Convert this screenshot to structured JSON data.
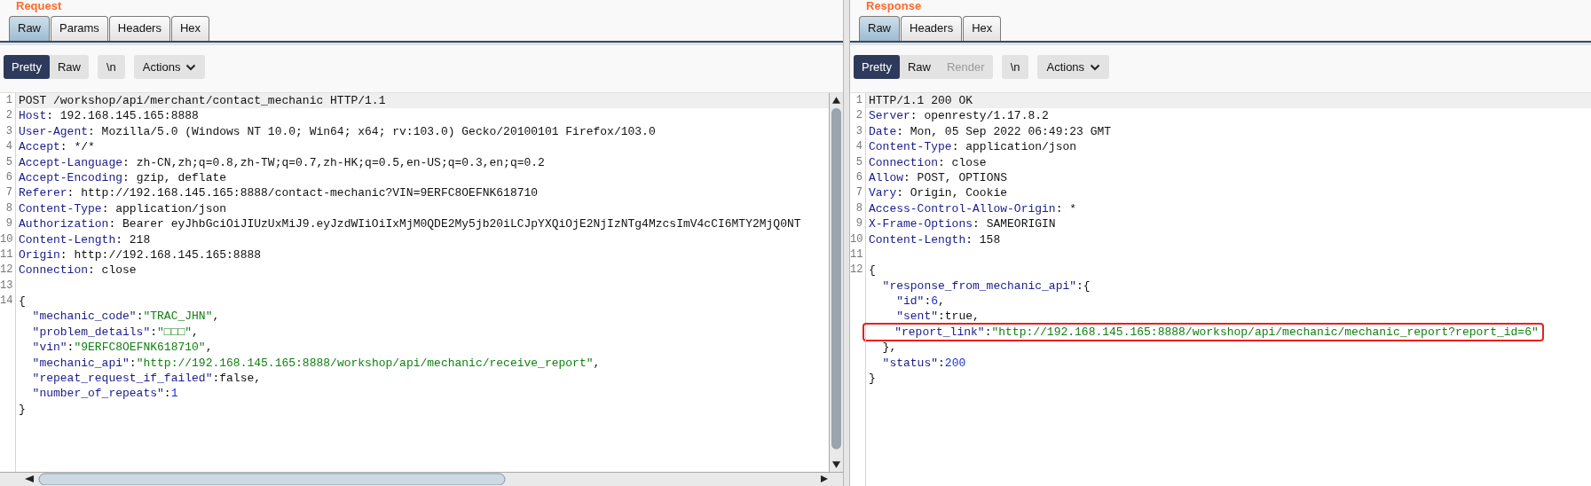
{
  "request": {
    "title": "Request",
    "scrollbars": true,
    "tabs": [
      {
        "label": "Raw",
        "selected": true
      },
      {
        "label": "Params",
        "selected": false
      },
      {
        "label": "Headers",
        "selected": false
      },
      {
        "label": "Hex",
        "selected": false
      }
    ],
    "view_modes": [
      {
        "label": "Pretty",
        "selected": true,
        "disabled": false
      },
      {
        "label": "Raw",
        "selected": false,
        "disabled": false
      }
    ],
    "newline_button": "\\n",
    "actions_button": "Actions",
    "lines": [
      {
        "num": "1",
        "current": true,
        "highlighted": false,
        "tokens": [
          {
            "kind": "text",
            "text": "POST /workshop/api/merchant/contact_mechanic HTTP/1.1"
          }
        ]
      },
      {
        "num": "2",
        "current": false,
        "highlighted": false,
        "tokens": [
          {
            "kind": "name",
            "text": "Host"
          },
          {
            "kind": "text",
            "text": ": 192.168.145.165:8888"
          }
        ]
      },
      {
        "num": "3",
        "current": false,
        "highlighted": false,
        "tokens": [
          {
            "kind": "name",
            "text": "User-Agent"
          },
          {
            "kind": "text",
            "text": ": Mozilla/5.0 (Windows NT 10.0; Win64; x64; rv:103.0) Gecko/20100101 Firefox/103.0"
          }
        ]
      },
      {
        "num": "4",
        "current": false,
        "highlighted": false,
        "tokens": [
          {
            "kind": "name",
            "text": "Accept"
          },
          {
            "kind": "text",
            "text": ": */*"
          }
        ]
      },
      {
        "num": "5",
        "current": false,
        "highlighted": false,
        "tokens": [
          {
            "kind": "name",
            "text": "Accept-Language"
          },
          {
            "kind": "text",
            "text": ": zh-CN,zh;q=0.8,zh-TW;q=0.7,zh-HK;q=0.5,en-US;q=0.3,en;q=0.2"
          }
        ]
      },
      {
        "num": "6",
        "current": false,
        "highlighted": false,
        "tokens": [
          {
            "kind": "name",
            "text": "Accept-Encoding"
          },
          {
            "kind": "text",
            "text": ": gzip, deflate"
          }
        ]
      },
      {
        "num": "7",
        "current": false,
        "highlighted": false,
        "tokens": [
          {
            "kind": "name",
            "text": "Referer"
          },
          {
            "kind": "text",
            "text": ": http://192.168.145.165:8888/contact-mechanic?VIN=9ERFC8OEFNK618710"
          }
        ]
      },
      {
        "num": "8",
        "current": false,
        "highlighted": false,
        "tokens": [
          {
            "kind": "name",
            "text": "Content-Type"
          },
          {
            "kind": "text",
            "text": ": application/json"
          }
        ]
      },
      {
        "num": "9",
        "current": false,
        "highlighted": false,
        "tokens": [
          {
            "kind": "name",
            "text": "Authorization"
          },
          {
            "kind": "text",
            "text": ": Bearer eyJhbGciOiJIUzUxMiJ9.eyJzdWIiOiIxMjM0QDE2My5jb20iLCJpYXQiOjE2NjIzNTg4MzcsImV4cCI6MTY2MjQ0NT"
          }
        ]
      },
      {
        "num": "10",
        "current": false,
        "highlighted": false,
        "tokens": [
          {
            "kind": "name",
            "text": "Content-Length"
          },
          {
            "kind": "text",
            "text": ": 218"
          }
        ]
      },
      {
        "num": "11",
        "current": false,
        "highlighted": false,
        "tokens": [
          {
            "kind": "name",
            "text": "Origin"
          },
          {
            "kind": "text",
            "text": ": http://192.168.145.165:8888"
          }
        ]
      },
      {
        "num": "12",
        "current": false,
        "highlighted": false,
        "tokens": [
          {
            "kind": "name",
            "text": "Connection"
          },
          {
            "kind": "text",
            "text": ": close"
          }
        ]
      },
      {
        "num": "13"
      },
      {
        "num": "14",
        "current": false,
        "highlighted": false,
        "tokens": [
          {
            "kind": "text",
            "text": "{"
          }
        ]
      },
      {
        "current": false,
        "highlighted": false,
        "tokens": [
          {
            "kind": "name",
            "text": "  \"mechanic_code\""
          },
          {
            "kind": "text",
            "text": ":"
          },
          {
            "kind": "string",
            "text": "\"TRAC_JHN\""
          },
          {
            "kind": "text",
            "text": ","
          }
        ]
      },
      {
        "current": false,
        "highlighted": false,
        "tokens": [
          {
            "kind": "name",
            "text": "  \"problem_details\""
          },
          {
            "kind": "text",
            "text": ":"
          },
          {
            "kind": "string",
            "text": "\"□□□\""
          },
          {
            "kind": "text",
            "text": ","
          }
        ]
      },
      {
        "current": false,
        "highlighted": false,
        "tokens": [
          {
            "kind": "name",
            "text": "  \"vin\""
          },
          {
            "kind": "text",
            "text": ":"
          },
          {
            "kind": "string",
            "text": "\"9ERFC8OEFNK618710\""
          },
          {
            "kind": "text",
            "text": ","
          }
        ]
      },
      {
        "current": false,
        "highlighted": false,
        "tokens": [
          {
            "kind": "name",
            "text": "  \"mechanic_api\""
          },
          {
            "kind": "text",
            "text": ":"
          },
          {
            "kind": "string",
            "text": "\"http://192.168.145.165:8888/workshop/api/mechanic/receive_report\""
          },
          {
            "kind": "text",
            "text": ","
          }
        ]
      },
      {
        "current": false,
        "highlighted": false,
        "tokens": [
          {
            "kind": "name",
            "text": "  \"repeat_request_if_failed\""
          },
          {
            "kind": "text",
            "text": ":false,"
          }
        ]
      },
      {
        "current": false,
        "highlighted": false,
        "tokens": [
          {
            "kind": "name",
            "text": "  \"number_of_repeats\""
          },
          {
            "kind": "text",
            "text": ":"
          },
          {
            "kind": "number",
            "text": "1"
          }
        ]
      },
      {
        "current": false,
        "highlighted": false,
        "tokens": [
          {
            "kind": "text",
            "text": "}"
          }
        ]
      }
    ]
  },
  "response": {
    "title": "Response",
    "tabs": [
      {
        "label": "Raw",
        "selected": true
      },
      {
        "label": "Headers",
        "selected": false
      },
      {
        "label": "Hex",
        "selected": false
      }
    ],
    "view_modes": [
      {
        "label": "Pretty",
        "selected": true,
        "disabled": false
      },
      {
        "label": "Raw",
        "selected": false,
        "disabled": false
      },
      {
        "label": "Render",
        "selected": false,
        "disabled": true
      }
    ],
    "newline_button": "\\n",
    "actions_button": "Actions",
    "lines": [
      {
        "num": "1",
        "current": true,
        "highlighted": false,
        "tokens": [
          {
            "kind": "text",
            "text": "HTTP/1.1 200 OK"
          }
        ]
      },
      {
        "num": "2",
        "current": false,
        "highlighted": false,
        "tokens": [
          {
            "kind": "name",
            "text": "Server"
          },
          {
            "kind": "text",
            "text": ": openresty/1.17.8.2"
          }
        ]
      },
      {
        "num": "3",
        "current": false,
        "highlighted": false,
        "tokens": [
          {
            "kind": "name",
            "text": "Date"
          },
          {
            "kind": "text",
            "text": ": Mon, 05 Sep 2022 06:49:23 GMT"
          }
        ]
      },
      {
        "num": "4",
        "current": false,
        "highlighted": false,
        "tokens": [
          {
            "kind": "name",
            "text": "Content-Type"
          },
          {
            "kind": "text",
            "text": ": application/json"
          }
        ]
      },
      {
        "num": "5",
        "current": false,
        "highlighted": false,
        "tokens": [
          {
            "kind": "name",
            "text": "Connection"
          },
          {
            "kind": "text",
            "text": ": close"
          }
        ]
      },
      {
        "num": "6",
        "current": false,
        "highlighted": false,
        "tokens": [
          {
            "kind": "name",
            "text": "Allow"
          },
          {
            "kind": "text",
            "text": ": POST, OPTIONS"
          }
        ]
      },
      {
        "num": "7",
        "current": false,
        "highlighted": false,
        "tokens": [
          {
            "kind": "name",
            "text": "Vary"
          },
          {
            "kind": "text",
            "text": ": Origin, Cookie"
          }
        ]
      },
      {
        "num": "8",
        "current": false,
        "highlighted": false,
        "tokens": [
          {
            "kind": "name",
            "text": "Access-Control-Allow-Origin"
          },
          {
            "kind": "text",
            "text": ": *"
          }
        ]
      },
      {
        "num": "9",
        "current": false,
        "highlighted": false,
        "tokens": [
          {
            "kind": "name",
            "text": "X-Frame-Options"
          },
          {
            "kind": "text",
            "text": ": SAMEORIGIN"
          }
        ]
      },
      {
        "num": "10",
        "current": false,
        "highlighted": false,
        "tokens": [
          {
            "kind": "name",
            "text": "Content-Length"
          },
          {
            "kind": "text",
            "text": ": 158"
          }
        ]
      },
      {
        "num": "11"
      },
      {
        "num": "12",
        "current": false,
        "highlighted": false,
        "tokens": [
          {
            "kind": "text",
            "text": "{"
          }
        ]
      },
      {
        "current": false,
        "highlighted": false,
        "tokens": [
          {
            "kind": "name",
            "text": "  \"response_from_mechanic_api\""
          },
          {
            "kind": "text",
            "text": ":{"
          }
        ]
      },
      {
        "current": false,
        "highlighted": false,
        "tokens": [
          {
            "kind": "name",
            "text": "    \"id\""
          },
          {
            "kind": "text",
            "text": ":"
          },
          {
            "kind": "number",
            "text": "6"
          },
          {
            "kind": "text",
            "text": ","
          }
        ]
      },
      {
        "current": false,
        "highlighted": false,
        "tokens": [
          {
            "kind": "name",
            "text": "    \"sent\""
          },
          {
            "kind": "text",
            "text": ":true,"
          }
        ]
      },
      {
        "current": false,
        "highlighted": true,
        "tokens": [
          {
            "kind": "name",
            "text": "    \"report_link\""
          },
          {
            "kind": "text",
            "text": ":"
          },
          {
            "kind": "string",
            "text": "\"http://192.168.145.165:8888/workshop/api/mechanic/mechanic_report?report_id=6\""
          }
        ]
      },
      {
        "current": false,
        "highlighted": false,
        "tokens": [
          {
            "kind": "text",
            "text": "  },"
          }
        ]
      },
      {
        "current": false,
        "highlighted": false,
        "tokens": [
          {
            "kind": "name",
            "text": "  \"status\""
          },
          {
            "kind": "text",
            "text": ":"
          },
          {
            "kind": "number",
            "text": "200"
          }
        ]
      },
      {
        "current": false,
        "highlighted": false,
        "tokens": [
          {
            "kind": "text",
            "text": "}"
          }
        ]
      }
    ]
  }
}
